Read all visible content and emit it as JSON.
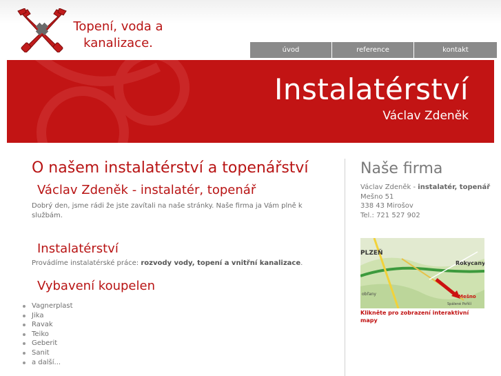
{
  "logo": {
    "icon": "crossed-pipe-wrenches",
    "line1": "Topení, voda a",
    "line2": "kanalizace."
  },
  "nav": {
    "items": [
      {
        "label": "úvod"
      },
      {
        "label": "reference"
      },
      {
        "label": "kontakt"
      }
    ]
  },
  "banner": {
    "title": "Instalatérství",
    "subtitle": "Václav Zdeněk"
  },
  "main": {
    "heading": "O našem instalatérství a topenářství",
    "sub1": "Václav Zdeněk - instalatér, topenář",
    "intro": "Dobrý den, jsme rádi že jste zavítali na naše stránky. Naše firma ja Vám plně k službám.",
    "sub2": "Instalatérství",
    "services_prefix": "Provádíme instalatérské práce:",
    "services_bold": "rozvody vody, topení a vnitřní kanalizace",
    "services_suffix": ".",
    "sub3": "Vybavení koupelen",
    "brands": [
      "Vagnerplast",
      "Jika",
      "Ravak",
      "Teiko",
      "Geberit",
      "Sanit",
      "a další..."
    ]
  },
  "sidebar": {
    "heading": "Naše firma",
    "name": "Václav Zdeněk - ",
    "name_bold": "instalatér, topenář",
    "street": "Mešno 51",
    "city": "338 43 Mirošov",
    "phone": "Tel.: 721 527 902",
    "map_labels": [
      "PLZEŇ",
      "Rokycany",
      "Mešno",
      "obřany",
      "Spálené Poříčí"
    ],
    "map_link": "Klikněte pro zobrazení interaktivní mapy"
  },
  "colors": {
    "brand_red": "#c21414",
    "nav_gray": "#8a8a8a",
    "heading_red": "#b81414"
  }
}
